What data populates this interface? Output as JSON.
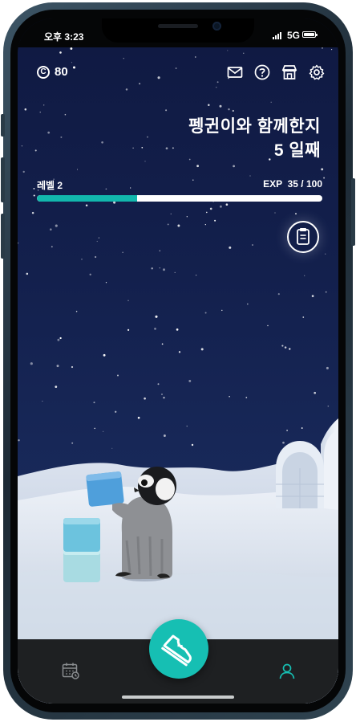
{
  "status_bar": {
    "time": "오후 3:23",
    "network": "5G"
  },
  "header": {
    "coins": "80",
    "coin_symbol": "C"
  },
  "top_icons": [
    "mail-icon",
    "help-icon",
    "shop-icon",
    "settings-icon"
  ],
  "title": {
    "line1": "펭귄이와 함께한지",
    "line2": "5 일째"
  },
  "progress": {
    "level_label": "레벨 2",
    "exp_label": "EXP  35 / 100",
    "exp_current": 35,
    "exp_max": 100
  },
  "side_button_icon": "clipboard-icon",
  "bottom_nav": {
    "left_icon": "calendar-icon",
    "center_icon": "shoe-icon",
    "right_icon": "profile-icon"
  },
  "colors": {
    "accent": "#16bfb3",
    "sky_top": "#101a43",
    "sky_bottom": "#1b2f60",
    "nav_bg": "#1e2022"
  }
}
